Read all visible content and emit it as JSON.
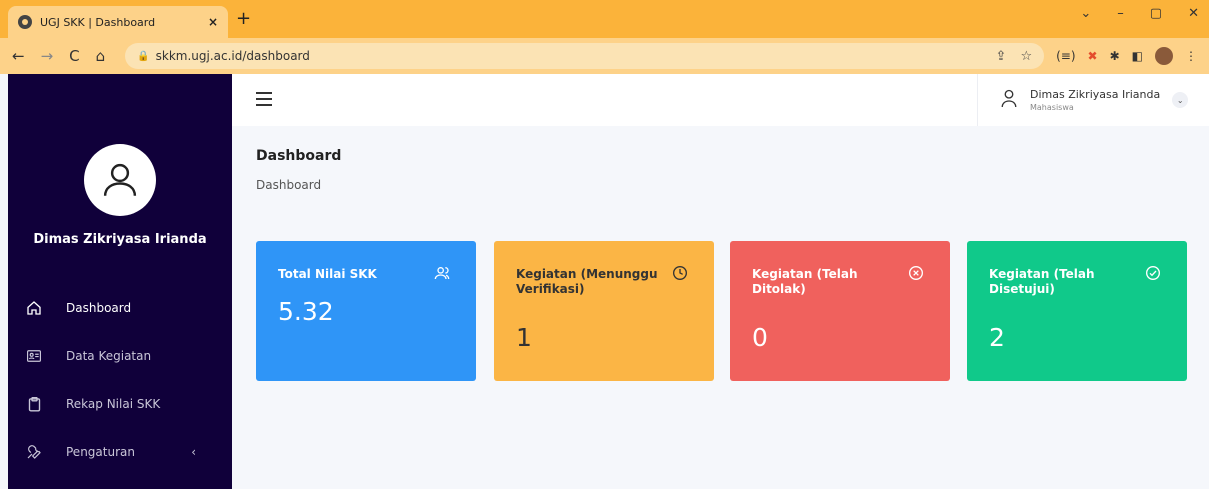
{
  "browser": {
    "tab_title": "UGJ SKK | Dashboard",
    "url": "skkm.ugj.ac.id/dashboard",
    "new_tab": "+",
    "close_tab": "×",
    "win_min": "–",
    "win_max": "▢",
    "win_close": "✕",
    "win_menu": "⌄",
    "back": "←",
    "forward": "→",
    "reload": "C",
    "home": "⌂",
    "ext_label": "(≡)"
  },
  "sidebar": {
    "profile_name": "Dimas Zikriyasa Irianda",
    "items": [
      {
        "label": "Dashboard",
        "icon": "home-icon",
        "active": true
      },
      {
        "label": "Data Kegiatan",
        "icon": "id-card-icon",
        "active": false
      },
      {
        "label": "Rekap Nilai SKK",
        "icon": "clipboard-icon",
        "active": false
      },
      {
        "label": "Pengaturan",
        "icon": "wrench-icon",
        "active": false,
        "chevron": "‹"
      }
    ]
  },
  "topbar": {
    "user_name": "Dimas Zikriyasa Irianda",
    "user_role": "Mahasiswa",
    "user_chevron": "⌄"
  },
  "main": {
    "page_title": "Dashboard",
    "breadcrumb": "Dashboard",
    "cards": [
      {
        "label": "Total Nilai SKK",
        "value": "5.32",
        "icon": "users-icon",
        "color": "#2f95f7"
      },
      {
        "label": "Kegiatan (Menunggu Verifikasi)",
        "value": "1",
        "icon": "clock-icon",
        "color": "#fbb545"
      },
      {
        "label": "Kegiatan (Telah Ditolak)",
        "value": "0",
        "icon": "x-circle-icon",
        "color": "#f0615d"
      },
      {
        "label": "Kegiatan (Telah Disetujui)",
        "value": "2",
        "icon": "check-circle-icon",
        "color": "#10c98a"
      }
    ]
  }
}
